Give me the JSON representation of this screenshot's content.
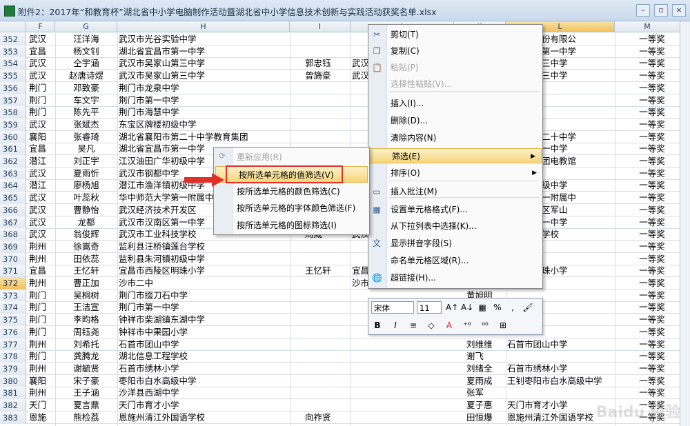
{
  "window": {
    "title": "附件2：2017年“和教育杯”湖北省中小学电脑制作活动暨湖北省中小学信息技术创新与实践活动获奖名单.xlsx",
    "buttons": [
      "–",
      "▫",
      "×"
    ]
  },
  "columns": [
    "F",
    "G",
    "H",
    "I",
    "J",
    "K",
    "L",
    "M"
  ],
  "selected_column": "L",
  "selected_row": "372",
  "rows": [
    {
      "n": "352",
      "F": "武汉",
      "G": "汪洋海",
      "H": "武汉市光谷实验中学",
      "I": "",
      "K": "",
      "L": "华科技股份有限公",
      "M": "一等奖"
    },
    {
      "n": "353",
      "F": "宜昌",
      "G": "杨文钊",
      "H": "湖北省宜昌市第一中学",
      "I": "",
      "K": "",
      "L": "省宜昌市第一中学",
      "M": "一等奖"
    },
    {
      "n": "354",
      "F": "武汉",
      "G": "仝宇涵",
      "H": "武汉市吴家山第三中学",
      "I": "郭忠钰",
      "J": "武汉",
      "K": "",
      "L": "吴家山第三中学",
      "M": "一等奖"
    },
    {
      "n": "355",
      "F": "武汉",
      "G": "赵唐诗煜",
      "H": "武汉市吴家山第三中学",
      "I": "曾旖豪",
      "J": "武汉",
      "K": "",
      "L": "吴家山第三中学",
      "M": "一等奖"
    },
    {
      "n": "356",
      "F": "荆门",
      "G": "邓致豪",
      "H": "荆门市龙泉中学",
      "I": "",
      "K": "",
      "L": "",
      "M": "一等奖"
    },
    {
      "n": "357",
      "F": "荆门",
      "G": "车文宇",
      "H": "荆门市第一中学",
      "I": "",
      "K": "",
      "L": "",
      "M": "一等奖"
    },
    {
      "n": "358",
      "F": "荆门",
      "G": "陈先平",
      "H": "荆门市海慧中学",
      "I": "",
      "K": "",
      "L": "",
      "M": "一等奖"
    },
    {
      "n": "359",
      "F": "武汉",
      "G": "张斌杰",
      "H": "东宝区牌楼初级中学",
      "I": "",
      "K": "",
      "L": "",
      "M": "一等奖"
    },
    {
      "n": "360",
      "F": "襄阳",
      "G": "张睿琦",
      "H": "湖北省襄阳市第二十中学教育集团",
      "I": "",
      "K": "",
      "L": "襄阳市第二十中学",
      "M": "一等奖"
    },
    {
      "n": "361",
      "F": "宜昌",
      "G": "吴凡",
      "H": "湖北省宜昌市第一中学",
      "I": "",
      "K": "",
      "L": "宜昌市第一中学",
      "M": "一等奖"
    },
    {
      "n": "362",
      "F": "潜江",
      "G": "刘正宇",
      "H": "江汉油田广华初级中学",
      "I": "",
      "K": "",
      "L": "田教育集团电教馆",
      "M": "一等奖"
    },
    {
      "n": "363",
      "F": "武汉",
      "G": "夏雨忻",
      "H": "武汉市钢都中学",
      "I": "",
      "K": "",
      "L": "钢都中学",
      "M": "一等奖"
    },
    {
      "n": "364",
      "F": "潜江",
      "G": "廖杨旭",
      "H": "潜江市渔洋镇初级中学",
      "I": "",
      "K": "",
      "L": "渔洋镇初级中学",
      "M": "一等奖"
    },
    {
      "n": "365",
      "F": "武汉",
      "G": "叶蕊秋",
      "H": "华中师范大学第一附属中学",
      "I": "",
      "K": "",
      "L": "范大学第一附属中",
      "M": "一等奖"
    },
    {
      "n": "366",
      "F": "武汉",
      "G": "曹静怡",
      "H": "武汉经济技术开发区",
      "I": "",
      "K": "",
      "L": "技术开发区军山",
      "M": "一等奖"
    },
    {
      "n": "367",
      "F": "武汉",
      "G": "龙都",
      "H": "武汉市汉南区第一中学",
      "I": "",
      "K": "",
      "L": "汉南区第一中学",
      "M": "一等奖"
    },
    {
      "n": "368",
      "F": "武汉",
      "G": "翁俊辉",
      "H": "武汉市工业科技学校",
      "I": "周威",
      "J": "武汉",
      "K": "",
      "L": "工业科技学校",
      "M": "一等奖"
    },
    {
      "n": "369",
      "F": "荆州",
      "G": "徐嵩奇",
      "H": "监利县汪桥镇莲台学校",
      "I": "",
      "K": "",
      "L": "",
      "M": "一等奖"
    },
    {
      "n": "370",
      "F": "荆州",
      "G": "田依蕊",
      "H": "监利县朱河镇初级中学",
      "I": "",
      "K": "",
      "L": "",
      "M": "一等奖"
    },
    {
      "n": "371",
      "F": "宜昌",
      "G": "王忆轩",
      "H": "宜昌市西陵区明珠小学",
      "I": "王忆轩",
      "J": "宜昌",
      "K": "",
      "L": "西陵区明珠小学",
      "M": "一等奖"
    },
    {
      "n": "372",
      "F": "荆州",
      "G": "曹正加",
      "H": "沙市二中",
      "I": "",
      "J": "沙市",
      "K": "",
      "L": "沙市二中",
      "M": "一等奖"
    },
    {
      "n": "373",
      "F": "荆门",
      "G": "吴桐树",
      "H": "荆门市掇刀石中学",
      "I": "",
      "K": "黄旭明",
      "L": "",
      "M": "一等奖"
    },
    {
      "n": "374",
      "F": "荆门",
      "G": "王洁宣",
      "H": "荆门市第一中学",
      "I": "",
      "K": "",
      "L": "",
      "M": "一等奖"
    },
    {
      "n": "375",
      "F": "荆门",
      "G": "李昀格",
      "H": "钟祥市柴湖镇东湖中学",
      "I": "",
      "K": "",
      "L": "",
      "M": "一等奖"
    },
    {
      "n": "376",
      "F": "荆门",
      "G": "周钰尧",
      "H": "钟祥市中果园小学",
      "I": "",
      "K": "",
      "L": "",
      "M": "一等奖"
    },
    {
      "n": "377",
      "F": "荆州",
      "G": "刘希托",
      "H": "石首市团山中学",
      "I": "",
      "K": "刘维维",
      "L": "石首市团山中学",
      "M": "一等奖"
    },
    {
      "n": "378",
      "F": "荆门",
      "G": "龚腾龙",
      "H": "湖北信息工程学校",
      "I": "",
      "K": "谢飞",
      "L": "",
      "M": "一等奖"
    },
    {
      "n": "379",
      "F": "荆州",
      "G": "谢毓贤",
      "H": "石首市绣林小学",
      "I": "",
      "K": "刘绪全",
      "L": "石首市绣林小学",
      "M": "一等奖"
    },
    {
      "n": "380",
      "F": "襄阳",
      "G": "宋子豪",
      "H": "枣阳市白水高级中学",
      "I": "",
      "K": "夏雨成",
      "L": "王钊枣阳市白水高级中学",
      "M": "一等奖"
    },
    {
      "n": "381",
      "F": "荆州",
      "G": "王子涵",
      "H": "沙洋县西湖中学",
      "I": "",
      "K": "张军",
      "L": "",
      "M": "一等奖"
    },
    {
      "n": "382",
      "F": "天门",
      "G": "夏言鼎",
      "H": "天门市育才小学",
      "I": "",
      "K": "夏子惠",
      "L": "天门市育才小学",
      "M": "一等奖"
    },
    {
      "n": "383",
      "F": "恩施",
      "G": "熊检荔",
      "H": "恩施州清江外国语学校",
      "I": "向祚贤",
      "K": "田恒爆",
      "L": "恩施州清江外国语学校",
      "M": "一等奖"
    }
  ],
  "context_menu": {
    "items": [
      {
        "label": "剪切(T)",
        "icon": "cut-icon",
        "glyph": "✂",
        "disabled": false
      },
      {
        "label": "复制(C)",
        "icon": "copy-icon",
        "glyph": "❐",
        "disabled": false
      },
      {
        "label": "粘贴(P)",
        "icon": "paste-icon",
        "glyph": "📋",
        "disabled": true
      },
      {
        "label": "选择性粘贴(V)...",
        "icon": "",
        "glyph": "",
        "disabled": true
      },
      {
        "label": "插入(I)...",
        "icon": "",
        "glyph": "",
        "disabled": false
      },
      {
        "label": "删除(D)...",
        "icon": "",
        "glyph": "",
        "disabled": false
      },
      {
        "label": "清除内容(N)",
        "icon": "",
        "glyph": "",
        "disabled": false
      },
      {
        "label": "筛选(E)",
        "icon": "",
        "glyph": "",
        "disabled": false,
        "highlight": true,
        "submenu": true
      },
      {
        "label": "排序(O)",
        "icon": "",
        "glyph": "",
        "disabled": false,
        "submenu": true
      },
      {
        "label": "插入批注(M)",
        "icon": "comment-icon",
        "glyph": "▭",
        "disabled": false
      },
      {
        "label": "设置单元格格式(F)...",
        "icon": "format-cells-icon",
        "glyph": "▦",
        "disabled": false
      },
      {
        "label": "从下拉列表中选择(K)...",
        "icon": "",
        "glyph": "",
        "disabled": false
      },
      {
        "label": "显示拼音字段(S)",
        "icon": "phonetic-icon",
        "glyph": "文",
        "disabled": false
      },
      {
        "label": "命名单元格区域(R)...",
        "icon": "",
        "glyph": "",
        "disabled": false
      },
      {
        "label": "超链接(H)...",
        "icon": "hyperlink-icon",
        "glyph": "🌐",
        "disabled": false
      }
    ]
  },
  "filter_submenu": {
    "items": [
      {
        "label": "重新应用(R)",
        "disabled": true
      },
      {
        "label": "按所选单元格的值筛选(V)",
        "disabled": false,
        "highlight": true
      },
      {
        "label": "按所选单元格的颜色筛选(C)",
        "disabled": false
      },
      {
        "label": "按所选单元格的字体颜色筛选(F)",
        "disabled": false
      },
      {
        "label": "按所选单元格的图标筛选(I)",
        "disabled": false
      }
    ]
  },
  "mini_toolbar": {
    "font": "宋体",
    "size": "11",
    "row1": [
      "A↑",
      "A↓",
      "▦",
      "%",
      ",",
      "🖌"
    ],
    "row2": [
      "B",
      "I",
      "≡",
      "◇",
      "A",
      "⁺⁰",
      "⁰⁰",
      "⊞"
    ]
  },
  "colors": {
    "highlight": "#f6d67a",
    "red": "#e0302a",
    "header": "#dfe6ef"
  },
  "watermark": "Baidu 经验"
}
